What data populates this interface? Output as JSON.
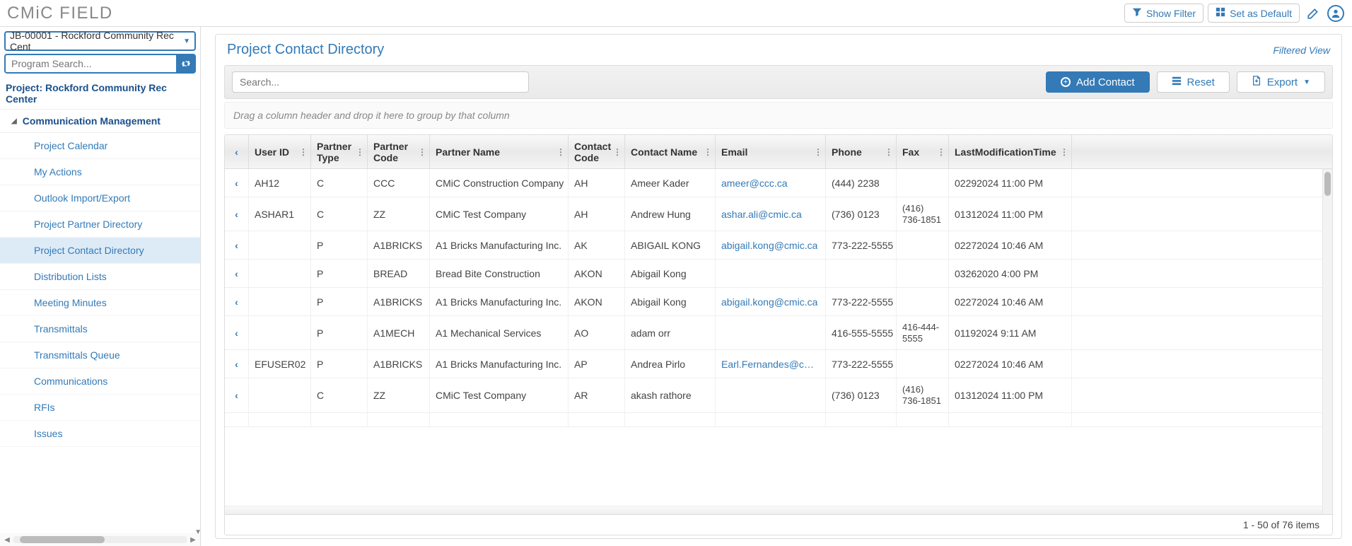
{
  "brand": "CMiC FIELD",
  "header_buttons": {
    "show_filter": "Show Filter",
    "set_default": "Set as Default"
  },
  "project_selector": "JB-00001 - Rockford Community Rec Cent",
  "program_search_placeholder": "Program Search...",
  "project_title": "Project: Rockford Community Rec Center",
  "category": "Communication Management",
  "nav_items": [
    "Project Calendar",
    "My Actions",
    "Outlook Import/Export",
    "Project Partner Directory",
    "Project Contact Directory",
    "Distribution Lists",
    "Meeting Minutes",
    "Transmittals",
    "Transmittals Queue",
    "Communications",
    "RFIs",
    "Issues"
  ],
  "nav_active_index": 4,
  "panel_title": "Project Contact Directory",
  "filtered_label": "Filtered View",
  "toolbar": {
    "search_placeholder": "Search...",
    "add_contact": "Add Contact",
    "reset": "Reset",
    "export": "Export"
  },
  "group_hint": "Drag a column header and drop it here to group by that column",
  "columns": {
    "user": "User ID",
    "ptype": "Partner Type",
    "pcode": "Partner Code",
    "pname": "Partner Name",
    "ccode": "Contact Code",
    "cname": "Contact Name",
    "email": "Email",
    "phone": "Phone",
    "fax": "Fax",
    "mod": "LastModificationTime"
  },
  "rows": [
    {
      "user": "AH12",
      "ptype": "C",
      "pcode": "CCC",
      "pname": "CMiC Construction Company",
      "ccode": "AH",
      "cname": "Ameer Kader",
      "email": "ameer@ccc.ca",
      "phone": "(444) 2238",
      "fax": "",
      "mod": "02292024 11:00 PM"
    },
    {
      "user": "ASHAR1",
      "ptype": "C",
      "pcode": "ZZ",
      "pname": "CMiC Test Company",
      "ccode": "AH",
      "cname": "Andrew Hung",
      "email": "ashar.ali@cmic.ca",
      "phone": "(736) 0123",
      "fax": "(416) 736-1851",
      "mod": "01312024 11:00 PM"
    },
    {
      "user": "",
      "ptype": "P",
      "pcode": "A1BRICKS",
      "pname": "A1 Bricks Manufacturing Inc.",
      "ccode": "AK",
      "cname": "ABIGAIL KONG",
      "email": "abigail.kong@cmic.ca",
      "phone": "773-222-5555",
      "fax": "",
      "mod": "02272024 10:46 AM"
    },
    {
      "user": "",
      "ptype": "P",
      "pcode": "BREAD",
      "pname": "Bread Bite Construction",
      "ccode": "AKON",
      "cname": "Abigail Kong",
      "email": "",
      "phone": "",
      "fax": "",
      "mod": "03262020 4:00 PM"
    },
    {
      "user": "",
      "ptype": "P",
      "pcode": "A1BRICKS",
      "pname": "A1 Bricks Manufacturing Inc.",
      "ccode": "AKON",
      "cname": "Abigail Kong",
      "email": "abigail.kong@cmic.ca",
      "phone": "773-222-5555",
      "fax": "",
      "mod": "02272024 10:46 AM"
    },
    {
      "user": "",
      "ptype": "P",
      "pcode": "A1MECH",
      "pname": "A1 Mechanical Services",
      "ccode": "AO",
      "cname": "adam orr",
      "email": "",
      "phone": "416-555-5555",
      "fax": "416-444-5555",
      "mod": "01192024 9:11 AM"
    },
    {
      "user": "EFUSER02",
      "ptype": "P",
      "pcode": "A1BRICKS",
      "pname": "A1 Bricks Manufacturing Inc.",
      "ccode": "AP",
      "cname": "Andrea Pirlo",
      "email": "Earl.Fernandes@cmi...",
      "phone": "773-222-5555",
      "fax": "",
      "mod": "02272024 10:46 AM"
    },
    {
      "user": "",
      "ptype": "C",
      "pcode": "ZZ",
      "pname": "CMiC Test Company",
      "ccode": "AR",
      "cname": "akash rathore",
      "email": "",
      "phone": "(736) 0123",
      "fax": "(416) 736-1851",
      "mod": "01312024 11:00 PM"
    }
  ],
  "pagination": "1 - 50 of 76 items"
}
